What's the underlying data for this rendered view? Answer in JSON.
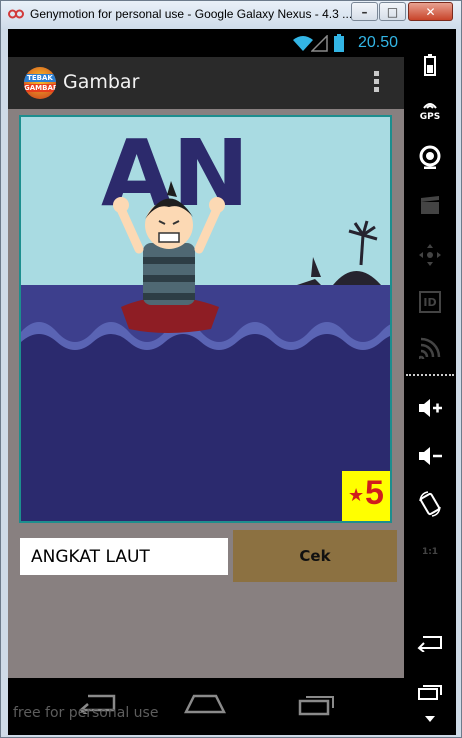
{
  "window": {
    "title": "Genymotion for personal use - Google Galaxy Nexus - 4.3 ...",
    "min_label": "–",
    "max_label": "□",
    "close_label": "✕"
  },
  "status": {
    "time": "20.50"
  },
  "app": {
    "logo_top": "TEBAK",
    "logo_bottom": "GAMBAR",
    "title": "Gambar"
  },
  "puzzle": {
    "image_text": "AN",
    "level_number": "5"
  },
  "answer": {
    "value": "ANGKAT LAUT"
  },
  "check_button": {
    "label": "Cek"
  },
  "watermark": "free for personal use",
  "sidebar": {
    "gps_label": "GPS",
    "id_label": "ID",
    "scale_label": "1:1"
  },
  "colors": {
    "accent": "#33b5e5",
    "sea_dark": "#2b2a6e",
    "button": "#8c7141",
    "badge": "#ffff00",
    "badge_text": "#d01d1d"
  }
}
